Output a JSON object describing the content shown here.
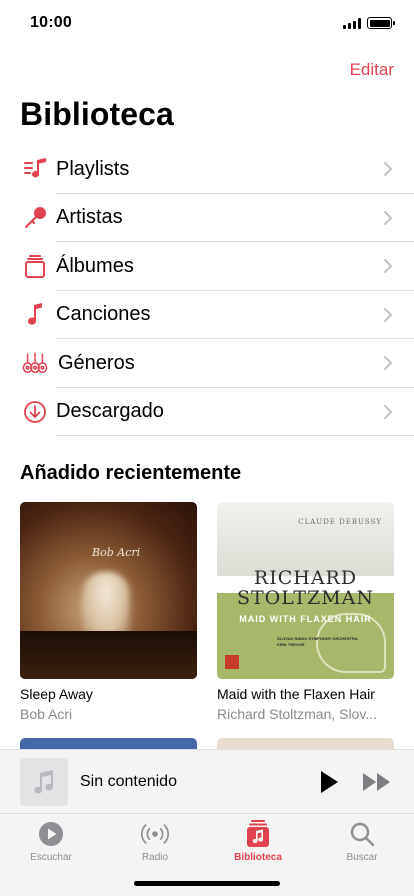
{
  "status_bar": {
    "time": "10:00"
  },
  "header": {
    "edit_label": "Editar",
    "title": "Biblioteca"
  },
  "menu": {
    "items": [
      {
        "label": "Playlists",
        "icon": "playlist-icon"
      },
      {
        "label": "Artistas",
        "icon": "microphone-icon"
      },
      {
        "label": "Álbumes",
        "icon": "album-stack-icon"
      },
      {
        "label": "Canciones",
        "icon": "music-note-icon"
      },
      {
        "label": "Géneros",
        "icon": "genres-icon"
      },
      {
        "label": "Descargado",
        "icon": "download-circle-icon"
      }
    ]
  },
  "recent": {
    "title": "Añadido recientemente",
    "albums": [
      {
        "title": "Sleep Away",
        "artist": "Bob Acri",
        "cover_text": "Bob Acri"
      },
      {
        "title": "Maid with the Flaxen Hair",
        "artist": "Richard Stoltzman, Slov...",
        "cover_composer": "CLAUDE DEBUSSY",
        "cover_artist_line1": "RICHARD",
        "cover_artist_line2": "STOLTZMAN",
        "cover_work": "MAID WITH FLAXEN HAIR",
        "cover_orchestra_line1": "SLOVAK RADIO SYMPHONY ORCHESTRA",
        "cover_orchestra_line2": "KIRK TREVOR"
      }
    ]
  },
  "mini_player": {
    "title": "Sin contenido"
  },
  "tabs": [
    {
      "label": "Escuchar",
      "icon": "play-circle-icon",
      "active": false
    },
    {
      "label": "Radio",
      "icon": "radio-icon",
      "active": false
    },
    {
      "label": "Biblioteca",
      "icon": "library-icon",
      "active": true
    },
    {
      "label": "Buscar",
      "icon": "search-icon",
      "active": false
    }
  ],
  "colors": {
    "accent": "#e0424f",
    "secondary_text": "#8a8a8e",
    "tab_inactive": "#8e8e93"
  }
}
